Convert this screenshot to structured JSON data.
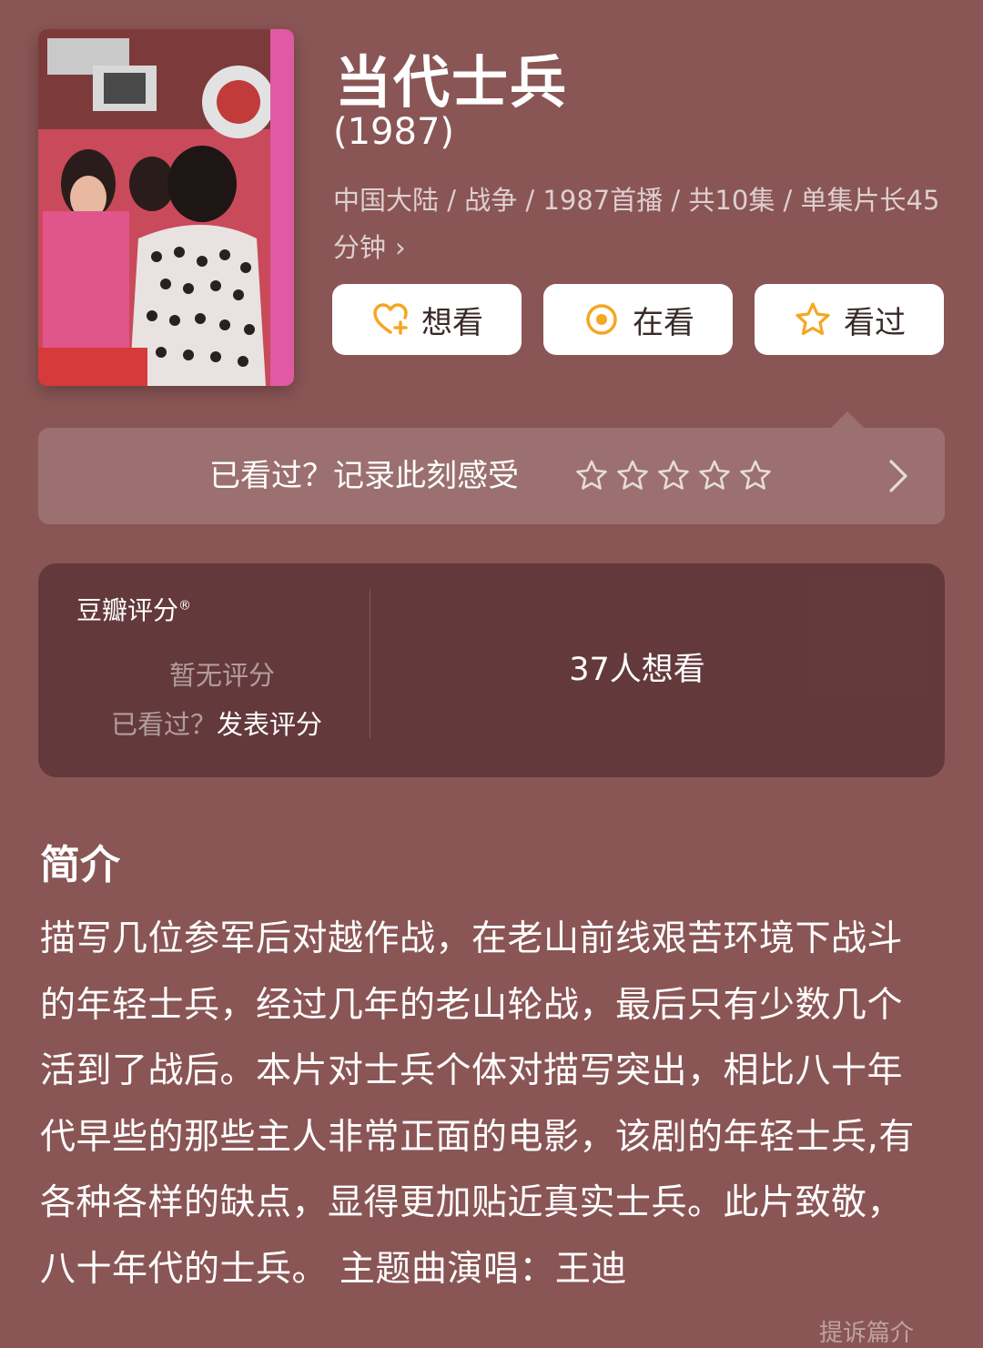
{
  "header": {
    "title": "当代士兵",
    "year": "(1987)",
    "meta": "中国大陆 / 战争 / 1987首播 / 共10集 / 单集片长45分钟",
    "meta_chevron": "›"
  },
  "actions": [
    {
      "label": "想看",
      "icon": "heart-plus-icon"
    },
    {
      "label": "在看",
      "icon": "target-icon"
    },
    {
      "label": "看过",
      "icon": "star-icon"
    }
  ],
  "record_bar": {
    "text": "已看过？记录此刻感受",
    "star_count": 5,
    "arrow_icon": "chevron-right-icon"
  },
  "rating": {
    "label": "豆瓣评分",
    "label_mark": "®",
    "no_rating": "暂无评分",
    "prompt_question": "已看过？",
    "prompt_action": "发表评分",
    "want_count": "37人想看"
  },
  "synopsis": {
    "title": "简介",
    "text": "描写几位参军后对越作战，在老山前线艰苦环境下战斗的年轻士兵，经过几年的老山轮战，最后只有少数几个活到了战后。本片对士兵个体对描写突出，相比八十年代早些的那些主人非常正面的电影，该剧的年轻士兵,有各种各样的缺点，显得更加贴近真实士兵。此片致敬，八十年代的士兵。 主题曲演唱：王迪",
    "more_label": "提诉篇介"
  },
  "colors": {
    "background": "#8a5555",
    "accent": "#f5a623",
    "card": "#6b3d40"
  }
}
